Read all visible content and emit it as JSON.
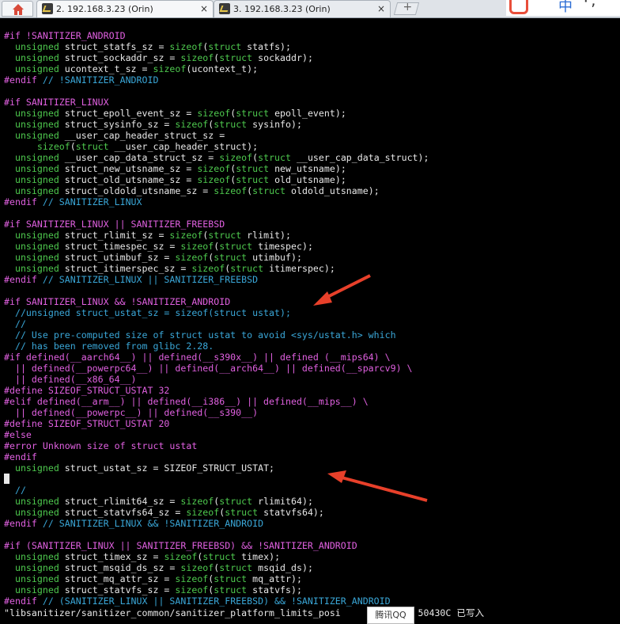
{
  "tabs": [
    {
      "label": "2. 192.168.3.23 (Orin)",
      "close": "×",
      "active": true
    },
    {
      "label": "3. 192.168.3.23 (Orin)",
      "close": "×",
      "active": false
    }
  ],
  "new_tab_symbol": "+",
  "ime": {
    "zh_label": "中",
    "punct": "·,"
  },
  "code_lines": [
    [
      [
        "pp",
        "#if !SANITIZER_ANDROID"
      ]
    ],
    [
      [
        "kw",
        "  unsigned"
      ],
      [
        "t",
        " struct_statfs_sz = "
      ],
      [
        "kw",
        "sizeof"
      ],
      [
        "t",
        "("
      ],
      [
        "kw",
        "struct"
      ],
      [
        "t",
        " statfs);"
      ]
    ],
    [
      [
        "kw",
        "  unsigned"
      ],
      [
        "t",
        " struct_sockaddr_sz = "
      ],
      [
        "kw",
        "sizeof"
      ],
      [
        "t",
        "("
      ],
      [
        "kw",
        "struct"
      ],
      [
        "t",
        " sockaddr);"
      ]
    ],
    [
      [
        "kw",
        "  unsigned"
      ],
      [
        "t",
        " ucontext_t_sz = "
      ],
      [
        "kw",
        "sizeof"
      ],
      [
        "t",
        "(ucontext_t);"
      ]
    ],
    [
      [
        "pp",
        "#endif"
      ],
      [
        "cm",
        " // !SANITIZER_ANDROID"
      ]
    ],
    [
      [
        "t",
        ""
      ]
    ],
    [
      [
        "pp",
        "#if SANITIZER_LINUX"
      ]
    ],
    [
      [
        "kw",
        "  unsigned"
      ],
      [
        "t",
        " struct_epoll_event_sz = "
      ],
      [
        "kw",
        "sizeof"
      ],
      [
        "t",
        "("
      ],
      [
        "kw",
        "struct"
      ],
      [
        "t",
        " epoll_event);"
      ]
    ],
    [
      [
        "kw",
        "  unsigned"
      ],
      [
        "t",
        " struct_sysinfo_sz = "
      ],
      [
        "kw",
        "sizeof"
      ],
      [
        "t",
        "("
      ],
      [
        "kw",
        "struct"
      ],
      [
        "t",
        " sysinfo);"
      ]
    ],
    [
      [
        "kw",
        "  unsigned"
      ],
      [
        "t",
        " __user_cap_header_struct_sz ="
      ]
    ],
    [
      [
        "kw",
        "      sizeof"
      ],
      [
        "t",
        "("
      ],
      [
        "kw",
        "struct"
      ],
      [
        "t",
        " __user_cap_header_struct);"
      ]
    ],
    [
      [
        "kw",
        "  unsigned"
      ],
      [
        "t",
        " __user_cap_data_struct_sz = "
      ],
      [
        "kw",
        "sizeof"
      ],
      [
        "t",
        "("
      ],
      [
        "kw",
        "struct"
      ],
      [
        "t",
        " __user_cap_data_struct);"
      ]
    ],
    [
      [
        "kw",
        "  unsigned"
      ],
      [
        "t",
        " struct_new_utsname_sz = "
      ],
      [
        "kw",
        "sizeof"
      ],
      [
        "t",
        "("
      ],
      [
        "kw",
        "struct"
      ],
      [
        "t",
        " new_utsname);"
      ]
    ],
    [
      [
        "kw",
        "  unsigned"
      ],
      [
        "t",
        " struct_old_utsname_sz = "
      ],
      [
        "kw",
        "sizeof"
      ],
      [
        "t",
        "("
      ],
      [
        "kw",
        "struct"
      ],
      [
        "t",
        " old_utsname);"
      ]
    ],
    [
      [
        "kw",
        "  unsigned"
      ],
      [
        "t",
        " struct_oldold_utsname_sz = "
      ],
      [
        "kw",
        "sizeof"
      ],
      [
        "t",
        "("
      ],
      [
        "kw",
        "struct"
      ],
      [
        "t",
        " oldold_utsname);"
      ]
    ],
    [
      [
        "pp",
        "#endif"
      ],
      [
        "cm",
        " // SANITIZER_LINUX"
      ]
    ],
    [
      [
        "t",
        ""
      ]
    ],
    [
      [
        "pp",
        "#if SANITIZER_LINUX || SANITIZER_FREEBSD"
      ]
    ],
    [
      [
        "kw",
        "  unsigned"
      ],
      [
        "t",
        " struct_rlimit_sz = "
      ],
      [
        "kw",
        "sizeof"
      ],
      [
        "t",
        "("
      ],
      [
        "kw",
        "struct"
      ],
      [
        "t",
        " rlimit);"
      ]
    ],
    [
      [
        "kw",
        "  unsigned"
      ],
      [
        "t",
        " struct_timespec_sz = "
      ],
      [
        "kw",
        "sizeof"
      ],
      [
        "t",
        "("
      ],
      [
        "kw",
        "struct"
      ],
      [
        "t",
        " timespec);"
      ]
    ],
    [
      [
        "kw",
        "  unsigned"
      ],
      [
        "t",
        " struct_utimbuf_sz = "
      ],
      [
        "kw",
        "sizeof"
      ],
      [
        "t",
        "("
      ],
      [
        "kw",
        "struct"
      ],
      [
        "t",
        " utimbuf);"
      ]
    ],
    [
      [
        "kw",
        "  unsigned"
      ],
      [
        "t",
        " struct_itimerspec_sz = "
      ],
      [
        "kw",
        "sizeof"
      ],
      [
        "t",
        "("
      ],
      [
        "kw",
        "struct"
      ],
      [
        "t",
        " itimerspec);"
      ]
    ],
    [
      [
        "pp",
        "#endif"
      ],
      [
        "cm",
        " // SANITIZER_LINUX || SANITIZER_FREEBSD"
      ]
    ],
    [
      [
        "t",
        ""
      ]
    ],
    [
      [
        "pp",
        "#if SANITIZER_LINUX && !SANITIZER_ANDROID"
      ]
    ],
    [
      [
        "cm",
        "  //unsigned struct_ustat_sz = sizeof(struct ustat);"
      ]
    ],
    [
      [
        "cm",
        "  //"
      ]
    ],
    [
      [
        "cm",
        "  // Use pre-computed size of struct ustat to avoid <sys/ustat.h> which"
      ]
    ],
    [
      [
        "cm",
        "  // has been removed from glibc 2.28."
      ]
    ],
    [
      [
        "pp",
        "#if defined(__aarch64__) || defined(__s390x__) || defined (__mips64) \\"
      ]
    ],
    [
      [
        "pp",
        "  || defined(__powerpc64__) || defined(__arch64__) || defined(__sparcv9) \\"
      ]
    ],
    [
      [
        "pp",
        "  || defined(__x86_64__)"
      ]
    ],
    [
      [
        "pp",
        "#define SIZEOF_STRUCT_USTAT "
      ],
      [
        "num",
        "32"
      ]
    ],
    [
      [
        "pp",
        "#elif defined(__arm__) || defined(__i386__) || defined(__mips__) \\"
      ]
    ],
    [
      [
        "pp",
        "  || defined(__powerpc__) || defined(__s390__)"
      ]
    ],
    [
      [
        "pp",
        "#define SIZEOF_STRUCT_USTAT "
      ],
      [
        "num",
        "20"
      ]
    ],
    [
      [
        "pp",
        "#else"
      ]
    ],
    [
      [
        "pp",
        "#error Unknown size of struct ustat"
      ]
    ],
    [
      [
        "pp",
        "#endif"
      ]
    ],
    [
      [
        "kw",
        "  unsigned"
      ],
      [
        "t",
        " struct_ustat_sz = SIZEOF_STRUCT_USTAT;"
      ]
    ],
    [
      [
        "t",
        ""
      ]
    ],
    [
      [
        "cm",
        "  //"
      ]
    ],
    [
      [
        "kw",
        "  unsigned"
      ],
      [
        "t",
        " struct_rlimit64_sz = "
      ],
      [
        "kw",
        "sizeof"
      ],
      [
        "t",
        "("
      ],
      [
        "kw",
        "struct"
      ],
      [
        "t",
        " rlimit64);"
      ]
    ],
    [
      [
        "kw",
        "  unsigned"
      ],
      [
        "t",
        " struct_statvfs64_sz = "
      ],
      [
        "kw",
        "sizeof"
      ],
      [
        "t",
        "("
      ],
      [
        "kw",
        "struct"
      ],
      [
        "t",
        " statvfs64);"
      ]
    ],
    [
      [
        "pp",
        "#endif"
      ],
      [
        "cm",
        " // SANITIZER_LINUX && !SANITIZER_ANDROID"
      ]
    ],
    [
      [
        "t",
        ""
      ]
    ],
    [
      [
        "pp",
        "#if (SANITIZER_LINUX || SANITIZER_FREEBSD) && !SANITIZER_ANDROID"
      ]
    ],
    [
      [
        "kw",
        "  unsigned"
      ],
      [
        "t",
        " struct_timex_sz = "
      ],
      [
        "kw",
        "sizeof"
      ],
      [
        "t",
        "("
      ],
      [
        "kw",
        "struct"
      ],
      [
        "t",
        " timex);"
      ]
    ],
    [
      [
        "kw",
        "  unsigned"
      ],
      [
        "t",
        " struct_msqid_ds_sz = "
      ],
      [
        "kw",
        "sizeof"
      ],
      [
        "t",
        "("
      ],
      [
        "kw",
        "struct"
      ],
      [
        "t",
        " msqid_ds);"
      ]
    ],
    [
      [
        "kw",
        "  unsigned"
      ],
      [
        "t",
        " struct_mq_attr_sz = "
      ],
      [
        "kw",
        "sizeof"
      ],
      [
        "t",
        "("
      ],
      [
        "kw",
        "struct"
      ],
      [
        "t",
        " mq_attr);"
      ]
    ],
    [
      [
        "kw",
        "  unsigned"
      ],
      [
        "t",
        " struct_statvfs_sz = "
      ],
      [
        "kw",
        "sizeof"
      ],
      [
        "t",
        "("
      ],
      [
        "kw",
        "struct"
      ],
      [
        "t",
        " statvfs);"
      ]
    ],
    [
      [
        "pp",
        "#endif"
      ],
      [
        "cm",
        " // (SANITIZER_LINUX || SANITIZER_FREEBSD) && !SANITIZER_ANDROID"
      ]
    ]
  ],
  "status_line": "\"libsanitizer/sanitizer_common/sanitizer_platform_limits_posi         95L, 50430C 已写入",
  "qq_popup": "腾讯QQ",
  "colors": {
    "preprocessor": "#e060e0",
    "keyword": "#4ec94e",
    "comment": "#3aa7d8",
    "arrow": "#e8402a"
  }
}
